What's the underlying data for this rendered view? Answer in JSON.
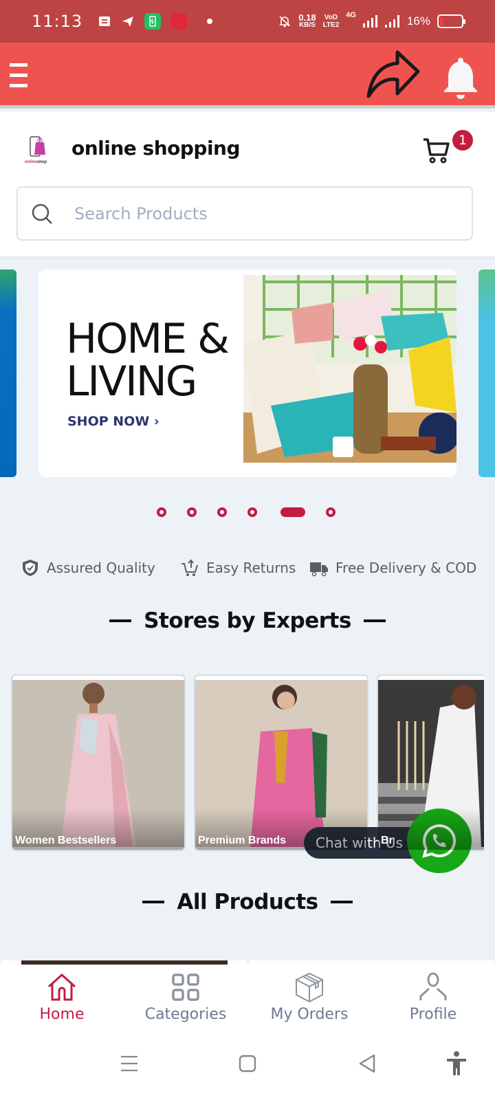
{
  "status_bar": {
    "time": "11:13",
    "network_speed": "0.18",
    "network_speed_unit": "KB/S",
    "volte_label_top": "VoD",
    "volte_label_bottom": "LTE2",
    "network_type": "4G",
    "battery_percent": "16%",
    "icons": [
      "message-icon",
      "telegram-icon",
      "battery-saver-icon",
      "app-icon",
      "notification-dot",
      "mute-icon",
      "signal-icon",
      "signal-icon-2",
      "battery-icon"
    ]
  },
  "app_bar": {
    "menu_icon": "hamburger-icon",
    "share_icon": "share-arrow-icon",
    "notification_icon": "bell-icon"
  },
  "header": {
    "logo_text": "onlineshop",
    "brand_name": "online shopping",
    "cart_count": "1"
  },
  "search": {
    "placeholder": "Search Products",
    "value": ""
  },
  "carousel": {
    "banner_title_line1": "HOME &",
    "banner_title_line2": "LIVING",
    "banner_cta": "SHOP NOW",
    "banner_cta_chevron": "›",
    "slide_count": 6,
    "active_slide": 5
  },
  "features": [
    {
      "icon": "shield-check-icon",
      "label": "Assured Quality"
    },
    {
      "icon": "cart-return-icon",
      "label": "Easy Returns"
    },
    {
      "icon": "truck-icon",
      "label": "Free Delivery & COD"
    }
  ],
  "stores_section": {
    "title": "Stores by Experts",
    "cards": [
      {
        "label": "Women Bestsellers"
      },
      {
        "label": "Premium Brands"
      },
      {
        "label": "Br"
      }
    ]
  },
  "chat": {
    "label": "Chat with Us",
    "icon": "whatsapp-icon"
  },
  "products_section": {
    "title": "All Products"
  },
  "bottom_nav": {
    "items": [
      {
        "label": "Home",
        "icon": "home-icon",
        "active": true
      },
      {
        "label": "Categories",
        "icon": "grid-icon",
        "active": false
      },
      {
        "label": "My Orders",
        "icon": "package-icon",
        "active": false
      },
      {
        "label": "Profile",
        "icon": "user-icon",
        "active": false
      }
    ]
  },
  "system_nav": {
    "buttons": [
      "recents-icon",
      "home-square-icon",
      "back-icon",
      "accessibility-icon"
    ]
  },
  "colors": {
    "status_bar": "#be4343",
    "app_bar": "#ef5350",
    "accent": "#c21c42",
    "background": "#edf2f7",
    "whatsapp": "#16a816",
    "chat_pill": "#28303d"
  }
}
